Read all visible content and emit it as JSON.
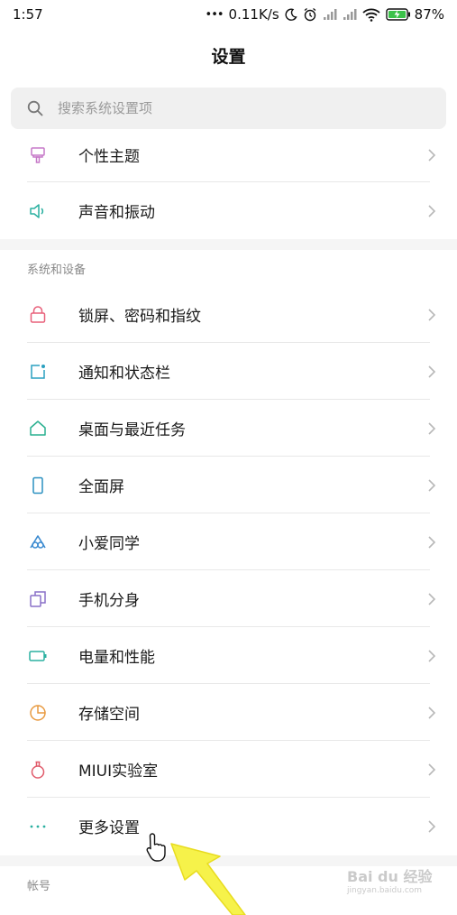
{
  "status_bar": {
    "time": "1:57",
    "dots": "•••",
    "speed": "0.11K/s",
    "battery": "87%"
  },
  "header": {
    "title": "设置"
  },
  "search": {
    "placeholder": "搜索系统设置项"
  },
  "top_group": [
    {
      "label": "个性主题",
      "icon": "theme-brush-icon",
      "color": "#c678c8"
    },
    {
      "label": "声音和振动",
      "icon": "speaker-icon",
      "color": "#2ab0a0"
    }
  ],
  "section_system": {
    "title": "系统和设备"
  },
  "system_items": [
    {
      "label": "锁屏、密码和指纹",
      "icon": "lock-icon",
      "color": "#e8607a"
    },
    {
      "label": "通知和状态栏",
      "icon": "notification-icon",
      "color": "#2aa0c0"
    },
    {
      "label": "桌面与最近任务",
      "icon": "home-icon",
      "color": "#2ab090"
    },
    {
      "label": "全面屏",
      "icon": "phone-icon",
      "color": "#2a90c0"
    },
    {
      "label": "小爱同学",
      "icon": "xiaoai-icon",
      "color": "#3a8ad0"
    },
    {
      "label": "手机分身",
      "icon": "clone-icon",
      "color": "#8a70c8"
    },
    {
      "label": "电量和性能",
      "icon": "battery-icon",
      "color": "#2ab0a0"
    },
    {
      "label": "存储空间",
      "icon": "storage-pie-icon",
      "color": "#e89a40"
    },
    {
      "label": "MIUI实验室",
      "icon": "flask-icon",
      "color": "#e05a6a"
    },
    {
      "label": "更多设置",
      "icon": "more-dots-icon",
      "color": "#2ab0a0"
    }
  ],
  "section_account": {
    "title": "帐号"
  },
  "watermark": {
    "line1": "Bai du 经验",
    "line2": "jingyan.baidu.com"
  }
}
